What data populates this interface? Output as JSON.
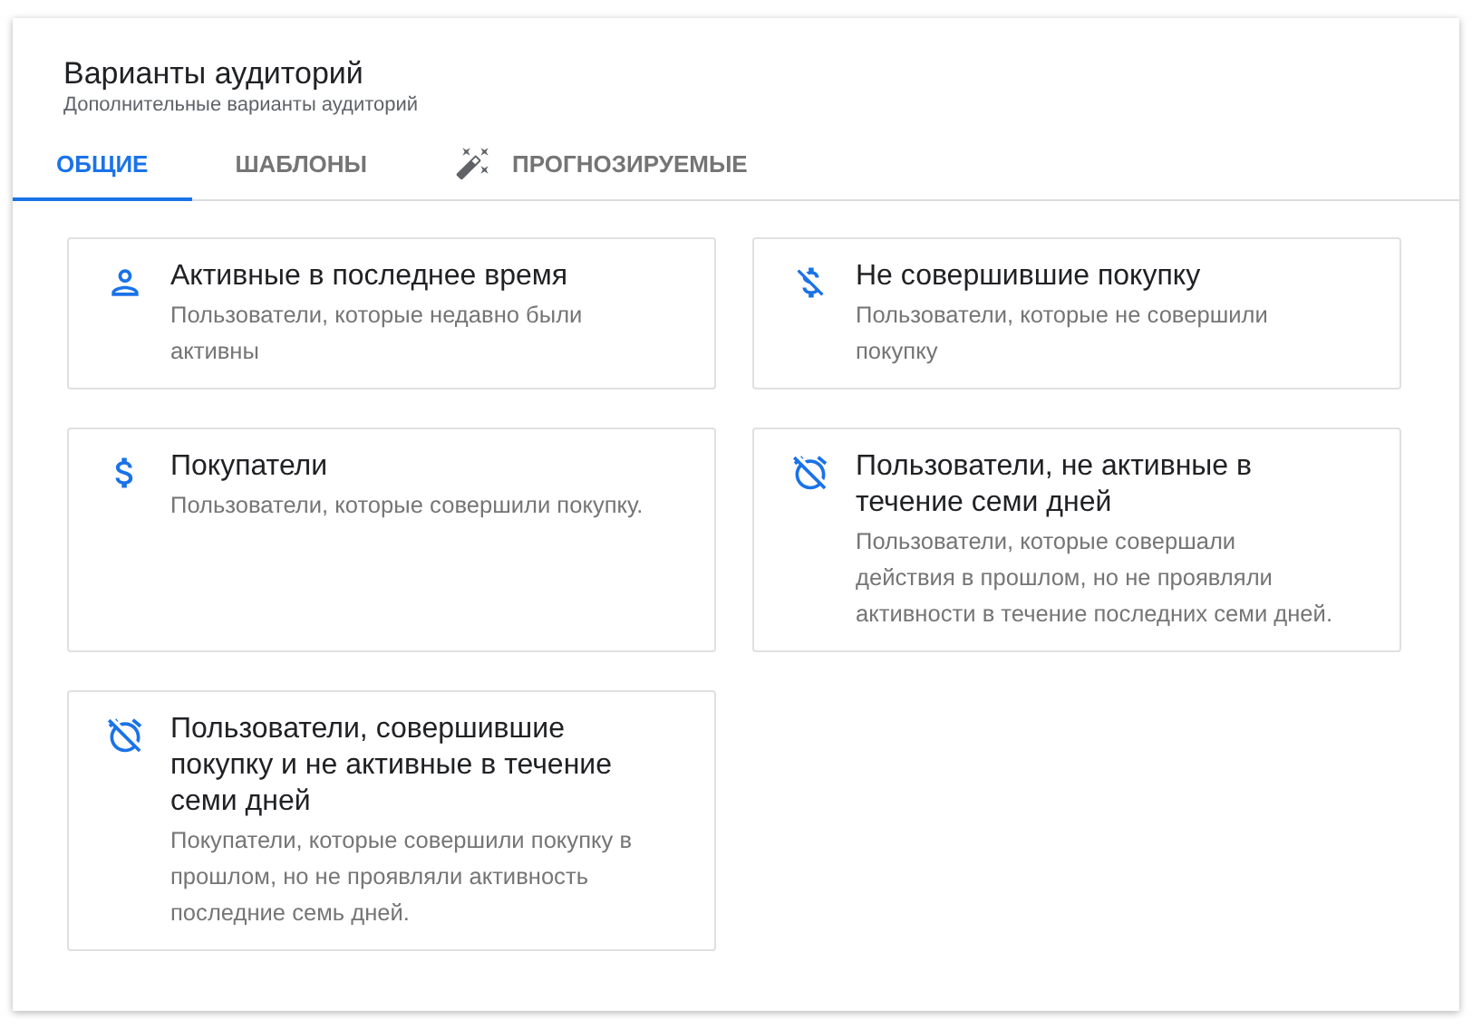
{
  "dialog": {
    "title": "Варианты аудиторий",
    "subtitle": "Дополнительные варианты аудиторий"
  },
  "tabs": [
    {
      "label": "ОБЩИЕ",
      "selected": true,
      "kind": "plain"
    },
    {
      "label": "ШАБЛОНЫ",
      "selected": false,
      "kind": "plain"
    },
    {
      "label": "ПРОГНОЗИРУЕМЫЕ",
      "selected": false,
      "kind": "magic"
    }
  ],
  "cards": [
    {
      "kind": "person",
      "title": "Активные в последнее время",
      "description": "Пользователи, которые недавно были активны"
    },
    {
      "kind": "money-off",
      "title": "Не совершившие покупку",
      "description": "Пользователи, которые не совершили покупку"
    },
    {
      "kind": "dollar",
      "title": "Покупатели",
      "description": "Пользователи, которые совершили покупку."
    },
    {
      "kind": "alarm-off",
      "title": "Пользователи, не активные в течение семи дней",
      "description": "Пользователи, которые совершали действия в прошлом, но не проявляли активности в течение последних семи дней."
    },
    {
      "kind": "alarm-off",
      "title": "Пользователи, совершившие покупку и не активные в течение семи дней",
      "description": "Покупатели, которые совершили покупку в прошлом, но не проявляли активность последние семь дней."
    }
  ]
}
